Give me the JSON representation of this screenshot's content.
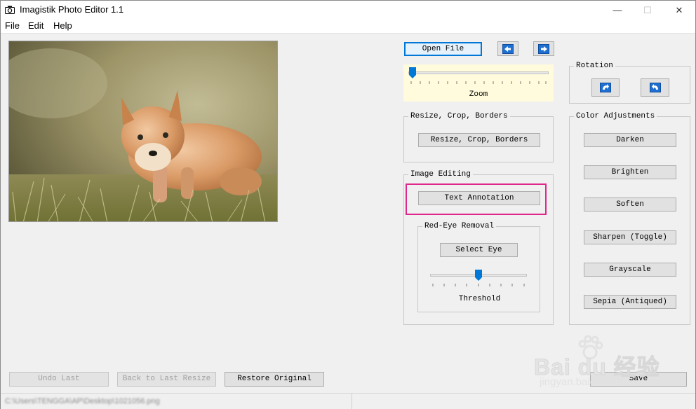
{
  "window": {
    "title": "Imagistik Photo Editor 1.1"
  },
  "titlebar": {
    "minimize": "—",
    "maximize": "☐",
    "close": "✕"
  },
  "menu": [
    "File",
    "Edit",
    "Help"
  ],
  "toolbar": {
    "open_file": "Open File",
    "prev_icon": "arrow-left-icon",
    "next_icon": "arrow-right-icon"
  },
  "zoom": {
    "label": "Zoom",
    "value": 0
  },
  "resize_group": {
    "title": "Resize, Crop, Borders",
    "button": "Resize, Crop, Borders"
  },
  "editing_group": {
    "title": "Image Editing",
    "text_annotation": "Text Annotation"
  },
  "redeye_group": {
    "title": "Red-Eye Removal",
    "select_eye": "Select Eye",
    "threshold_label": "Threshold",
    "threshold_value": 0.5
  },
  "rotation_group": {
    "title": "Rotation",
    "rotate_right_icon": "rotate-clockwise-icon",
    "rotate_left_icon": "rotate-counterclockwise-icon"
  },
  "color_group": {
    "title": "Color Adjustments",
    "buttons": [
      "Darken",
      "Brighten",
      "Soften",
      "Sharpen (Toggle)",
      "Grayscale",
      "Sepia (Antiqued)"
    ]
  },
  "bottom": {
    "undo": "Undo Last",
    "back_resize": "Back to Last Resize",
    "restore": "Restore Original",
    "save": "Save"
  },
  "status": {
    "path": "C:\\Users\\TENGGA\\AP\\Desktop\\1021056.png"
  },
  "watermark": {
    "brand": "Bai du 经验",
    "url": "jingyan.baidu.com"
  },
  "colors": {
    "accent": "#0078d7",
    "highlight": "#e0288c",
    "zoom_bg": "#fffbdc"
  }
}
